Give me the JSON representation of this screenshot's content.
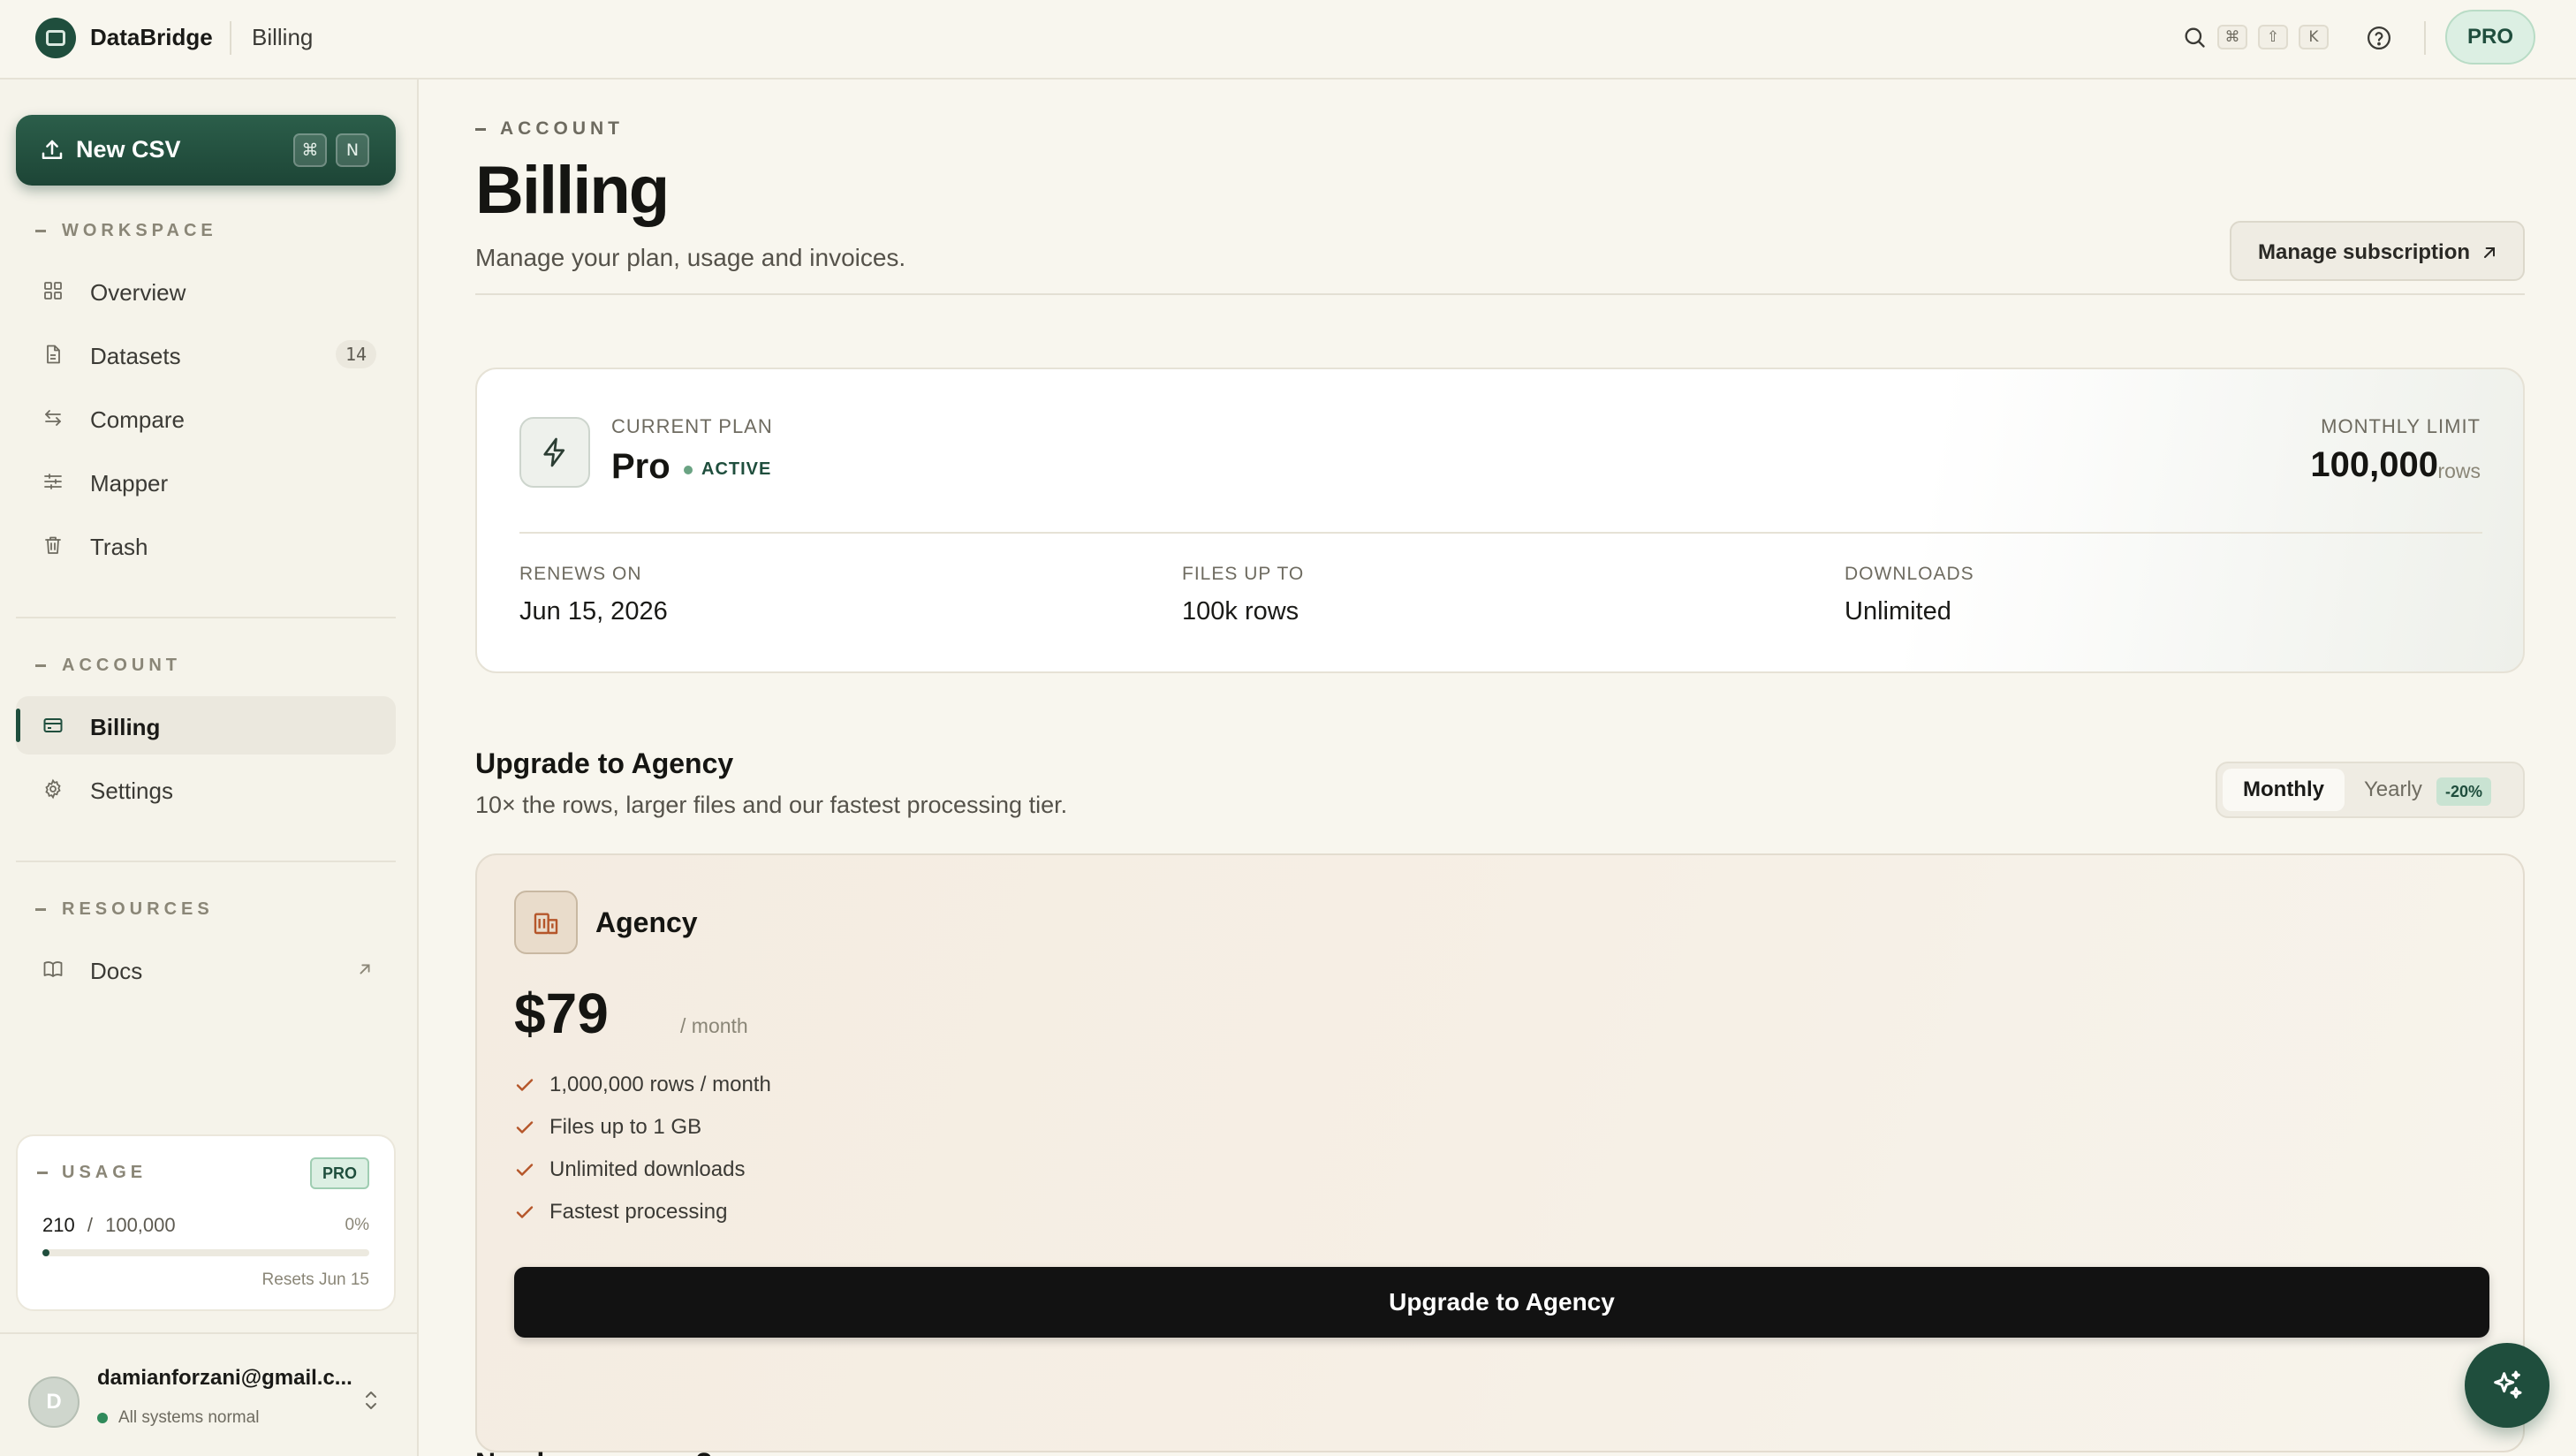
{
  "app": {
    "name": "DataBridge",
    "current_page": "Billing"
  },
  "topbar": {
    "search_icon": "search-icon",
    "shortcut_keys": [
      "⌘",
      "⇧",
      "K"
    ],
    "help_icon": "help-circle-icon",
    "plan_badge": "PRO"
  },
  "sidebar": {
    "new_button": {
      "label": "New CSV",
      "keys": [
        "⌘",
        "N"
      ],
      "icon": "upload-icon"
    },
    "workspace": {
      "heading": "WORKSPACE",
      "items": [
        {
          "label": "Overview",
          "icon": "grid-icon"
        },
        {
          "label": "Datasets",
          "icon": "file-icon",
          "count": "14"
        },
        {
          "label": "Compare",
          "icon": "arrows-swap-icon"
        },
        {
          "label": "Mapper",
          "icon": "sliders-icon"
        },
        {
          "label": "Trash",
          "icon": "trash-icon"
        }
      ]
    },
    "account": {
      "heading": "ACCOUNT",
      "items": [
        {
          "label": "Billing",
          "icon": "credit-card-icon",
          "active": true
        },
        {
          "label": "Settings",
          "icon": "gear-icon"
        }
      ]
    },
    "resources": {
      "heading": "RESOURCES",
      "items": [
        {
          "label": "Docs",
          "icon": "book-icon",
          "external": true
        }
      ]
    },
    "usage": {
      "heading": "USAGE",
      "badge": "PRO",
      "used": "210",
      "separator": "/",
      "limit": "100,000",
      "percent_label": "0%",
      "progress_fraction": 0.0021,
      "resets": "Resets Jun 15"
    },
    "user": {
      "avatar_initial": "D",
      "email": "damianforzani@gmail.c...",
      "status": "All systems normal"
    }
  },
  "main": {
    "eyebrow": "ACCOUNT",
    "title": "Billing",
    "subtitle": "Manage your plan, usage and invoices.",
    "manage_button": "Manage subscription",
    "current_plan": {
      "label": "CURRENT PLAN",
      "name": "Pro",
      "status": "ACTIVE",
      "limit_label": "MONTHLY LIMIT",
      "limit_value": "100,000",
      "limit_unit": "rows",
      "stats": [
        {
          "label": "RENEWS ON",
          "value": "Jun 15, 2026"
        },
        {
          "label": "FILES UP TO",
          "value": "100k rows"
        },
        {
          "label": "DOWNLOADS",
          "value": "Unlimited"
        }
      ]
    },
    "upgrade": {
      "title": "Upgrade to Agency",
      "subtitle": "10× the rows, larger files and our fastest processing tier.",
      "billing_toggle": {
        "monthly": "Monthly",
        "yearly": "Yearly",
        "discount": "-20%"
      },
      "plan": {
        "name": "Agency",
        "price": "$79",
        "period": "/ month",
        "features": [
          "1,000,000 rows / month",
          "Files up to 1 GB",
          "Unlimited downloads",
          "Fastest processing"
        ],
        "cta": "Upgrade to Agency"
      }
    },
    "next_section_title": "Need more rows?"
  },
  "colors": {
    "brand": "#1f4e3d",
    "background": "#f8f6ee",
    "accent_light": "#dcefe3",
    "cta": "#121212"
  }
}
